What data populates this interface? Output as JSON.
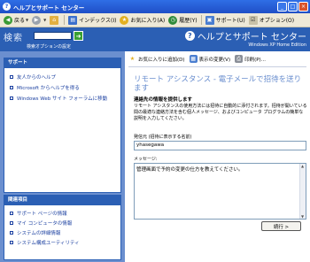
{
  "window": {
    "title": "ヘルプとサポート センター",
    "min": "_",
    "max": "□",
    "close": "×"
  },
  "toolbar": {
    "back": "戻る",
    "index": "インデックス(I)",
    "favorites": "お気に入り(A)",
    "history": "履歴(Y)",
    "support": "サポート(U)",
    "options": "オプション(O)"
  },
  "header": {
    "search_label": "検索",
    "go": "➜",
    "search_options": "検索オプションの設定",
    "app_title": "ヘルプとサポート センター",
    "edition": "Windows XP Home Edition",
    "help_glyph": "?"
  },
  "sidebar": {
    "support_head": "サポート",
    "support_items": [
      "友人からのヘルプ",
      "Microsoft からヘルプを得る",
      "Windows Web サイト フォーラムに移動"
    ],
    "related_head": "関連項目",
    "related_items": [
      "サポート ページの情報",
      "マイ コンピュータの情報",
      "システムの詳細情報",
      "システム構成ユーティリティ"
    ]
  },
  "main": {
    "actions": {
      "add_favorites": "お気に入りに追加(D)",
      "change_view": "表示の変更(V)",
      "print": "印刷(P)..."
    },
    "title": "リモート アシスタンス - 電子メールで招待を送ります",
    "section_title": "連絡先の情報を提供します",
    "description": "リモート アシスタンスの使用方法には招待に自動的に添付されます。招待が開いている間の最適な連絡方法を含む個人メッセージ、およびコンピュータ プログラムの簡単な説明を入力してください。",
    "from_label": "発信元 (招待に表示する名前)",
    "from_value": "yhasegawa",
    "message_label": "メッセージ:",
    "message_value": "管理画面で予約の変更の仕方を教えてください。",
    "next_button": "続行 >"
  },
  "colors": {
    "header_blue": "#2b5fb4",
    "sidebar_bg": "#6b8fcf",
    "title_light_blue": "#6b8fcf"
  }
}
